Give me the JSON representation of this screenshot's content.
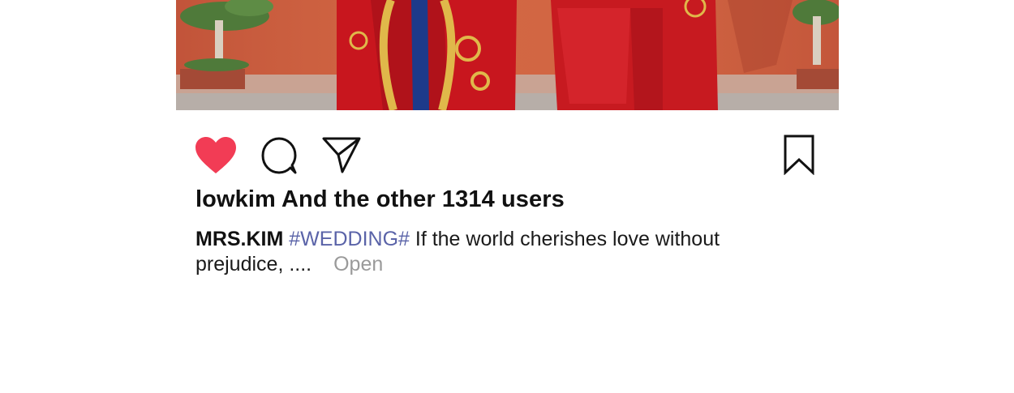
{
  "post": {
    "likes_text": "lowkim And the other 1314 users",
    "caption": {
      "author": "MRS.KIM",
      "hashtag": "#WEDDING#",
      "text": "If the world cherishes love without prejudice, ....",
      "more_label": "Open"
    }
  },
  "icons": {
    "like": "heart-filled-icon",
    "comment": "speech-bubble-icon",
    "share": "paper-plane-icon",
    "save": "bookmark-icon"
  },
  "colors": {
    "like_active": "#f23c55",
    "hashtag": "#5a63a8",
    "more_link": "#9a9a9a",
    "text": "#111111"
  }
}
